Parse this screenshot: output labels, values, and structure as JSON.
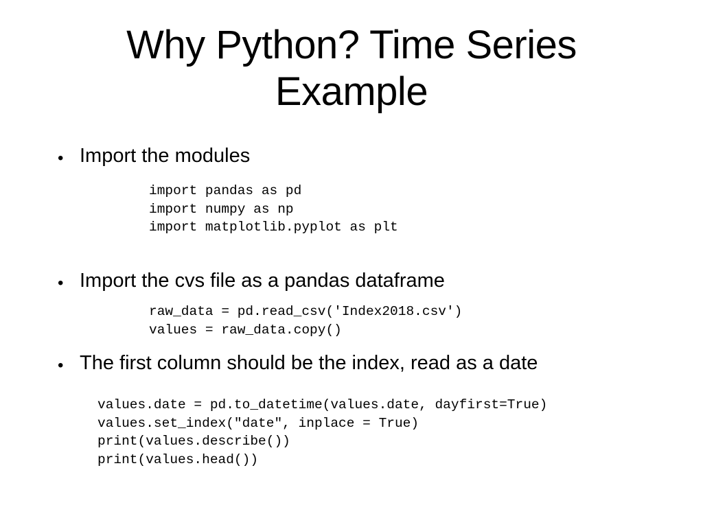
{
  "slide": {
    "title_line1": "Why Python? Time Series",
    "title_line2": "Example",
    "bullets": [
      {
        "marker": "•",
        "text": "Import the modules",
        "code": [
          "import pandas as pd",
          "import numpy as np",
          "import matplotlib.pyplot as plt"
        ]
      },
      {
        "marker": "•",
        "text": "Import the cvs file as a pandas dataframe",
        "code": [
          "raw_data = pd.read_csv('Index2018.csv')",
          "values = raw_data.copy()"
        ]
      },
      {
        "marker": "•",
        "text": "The first column should be the index, read as a date",
        "code": [
          "values.date = pd.to_datetime(values.date, dayfirst=True)",
          "values.set_index(\"date\", inplace = True)",
          "print(values.describe())",
          "print(values.head())"
        ]
      }
    ]
  }
}
